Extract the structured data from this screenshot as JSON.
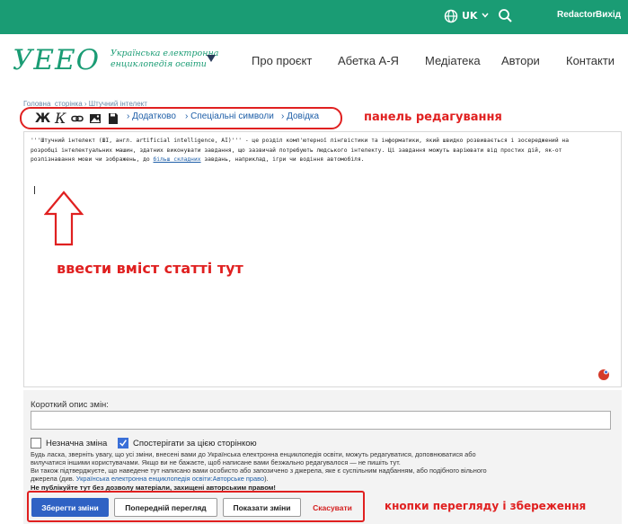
{
  "topbar": {
    "language": "UK",
    "user": "Redactor",
    "logout": "Вихід",
    "color": "#1a9c74"
  },
  "logo": {
    "mark": "УЕЕО",
    "subtitle_line1": "Українська електронна",
    "subtitle_line2": "енциклопедія освіти"
  },
  "nav": {
    "items": [
      "Про проєкт",
      "Абетка А-Я",
      "Медіатека",
      "Автори",
      "Контакти"
    ]
  },
  "breadcrumb": "Головна_сторінка › Штучний інтелект",
  "toolbar": {
    "bold_label": "Ж",
    "italic_label": "К",
    "icons": [
      "link-icon",
      "image-icon",
      "save-icon"
    ],
    "advanced": "› Додатково",
    "special_chars": "› Спеціальні символи",
    "help": "› Довідка"
  },
  "annotations": {
    "toolbar_label": "панель редагування",
    "content_label": "ввести вміст статті тут",
    "buttons_label": "кнопки перегляду і збереження",
    "accent": "#e02020"
  },
  "editor": {
    "line1": "'''Штучний інтелект (ШІ, англ. artificial intelligence, AI)''' - це розділ комп'ютерної лінгвістики та інформатики, який швидко розвивається і зосереджений на",
    "line2": "розробці інтелектуальних машин, здатних виконувати завдання, що зазвичай потребують людського інтелекту. Ці завдання можуть варіювати від простих дій, як-от",
    "line3_a": "розпізнавання мови чи зображень, до ",
    "line3_link": "більш складних",
    "line3_b": " завдань, наприклад, ігри чи водіння автомобіля."
  },
  "summary": {
    "label": "Короткий опис змін:",
    "value": ""
  },
  "options": {
    "minor_edit": "Незначна зміна",
    "minor_checked": false,
    "watch_page": "Спостерігати за цією сторінкою",
    "watch_checked": true
  },
  "legal": {
    "line1": "Будь ласка, зверніть увагу, що усі зміни, внесені вами до Українська електронна енциклопедія освіти, можуть редагуватися, доповнюватися або",
    "line2": "вилучатися іншими користувачами. Якщо ви не бажаєте, щоб написане вами безжально редагувалося — не пишіть тут.",
    "line3": "Ви також підтверджуєте, що наведене тут написано вами особисто або запозичено з джерела, яке є суспільним надбанням, або подібного вільного",
    "line4_a": "джерела (див. ",
    "line4_link": "Українська електронна енциклопедія освіти:Авторське право",
    "line4_b": ").",
    "warning": "Не публікуйте тут без дозволу матеріали, захищені авторським правом!"
  },
  "buttons": {
    "save": "Зберегти зміни",
    "preview": "Попередній перегляд",
    "diff": "Показати зміни",
    "cancel": "Скасувати"
  }
}
